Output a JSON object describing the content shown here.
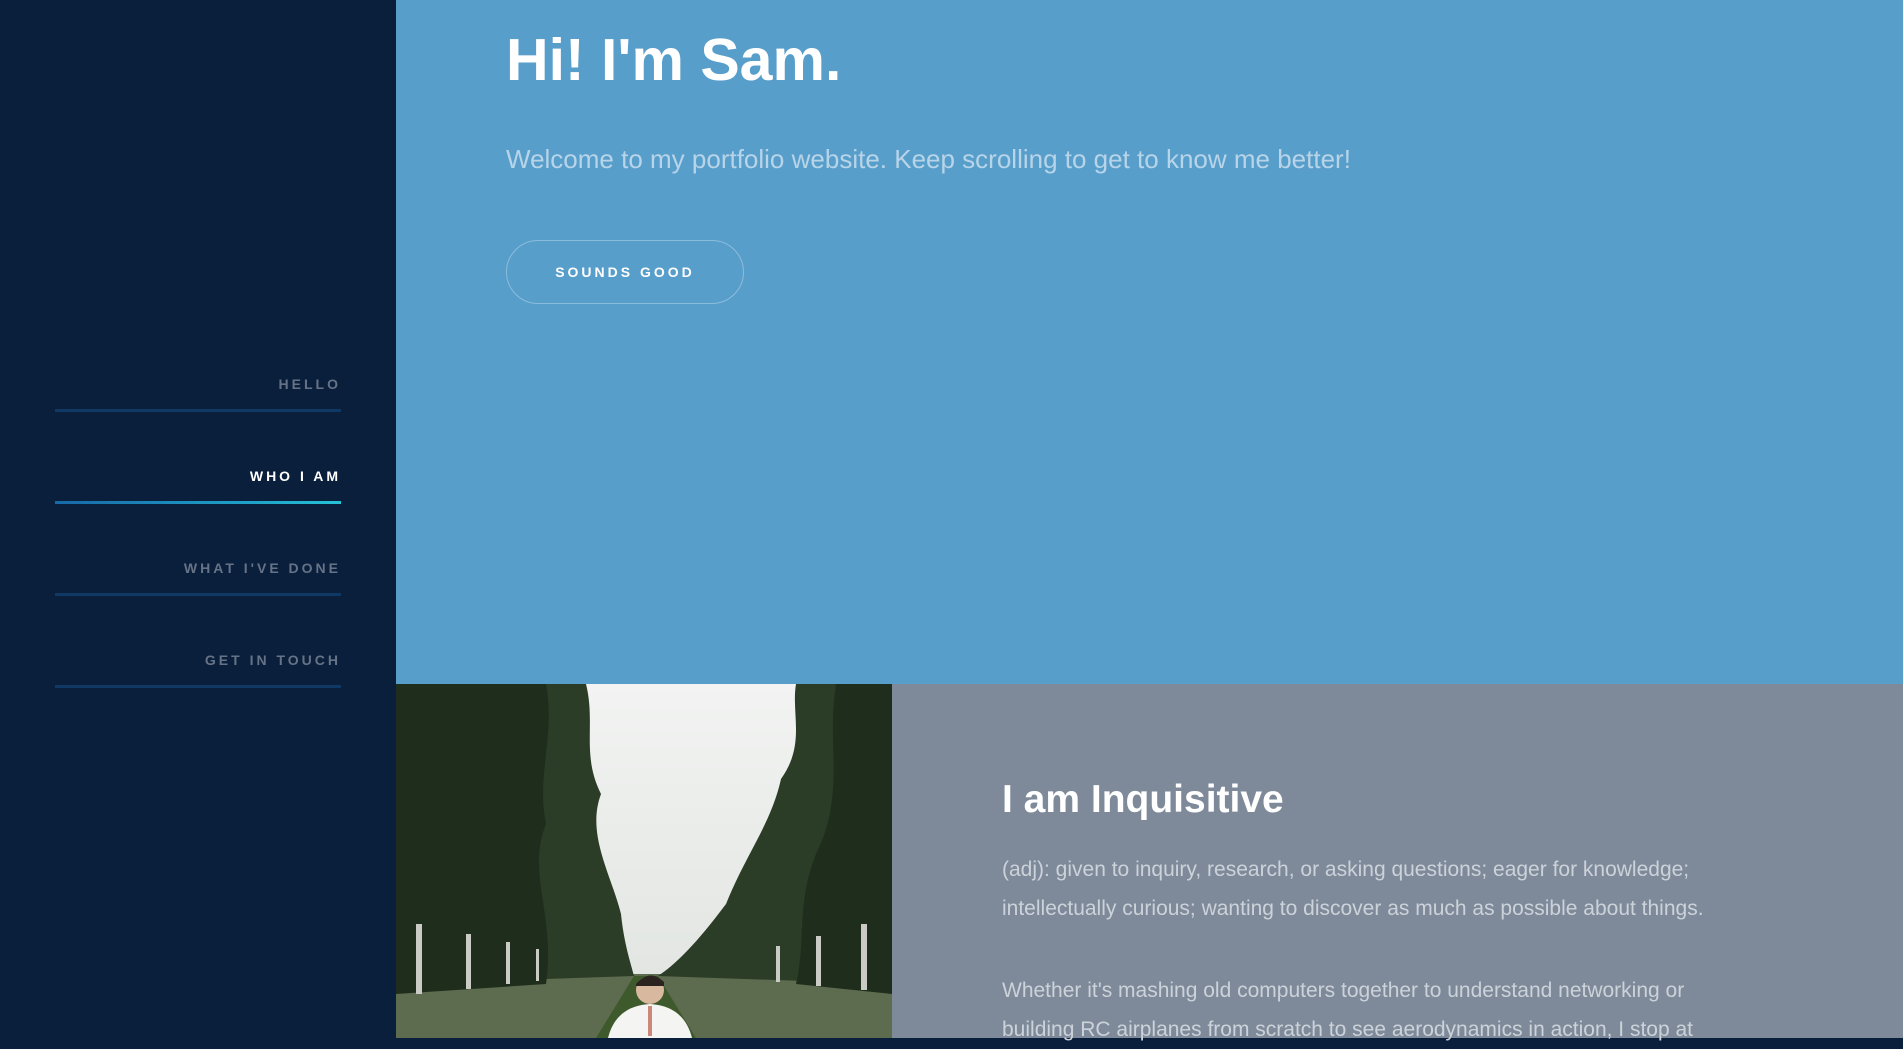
{
  "nav": {
    "items": [
      {
        "label": "HELLO",
        "active": false
      },
      {
        "label": "WHO I AM",
        "active": true
      },
      {
        "label": "WHAT I'VE DONE",
        "active": false
      },
      {
        "label": "GET IN TOUCH",
        "active": false
      }
    ]
  },
  "hero": {
    "title": "Hi! I'm Sam.",
    "subtitle": "Welcome to my portfolio website. Keep scrolling to get to know me better!",
    "button_label": "SOUNDS GOOD"
  },
  "about": {
    "title": "I am Inquisitive",
    "definition": "(adj): given to inquiry, research, or asking questions; eager for knowledge; intellectually curious; wanting to discover as much as possible about things.",
    "body": "Whether it's mashing old computers together to understand networking or building RC airplanes from scratch to see aerodynamics in action, I stop at"
  },
  "colors": {
    "sidebar": "#0a1f3c",
    "hero": "#589ecb",
    "about": "#7e8a9a",
    "accent": "#26c2d6"
  }
}
